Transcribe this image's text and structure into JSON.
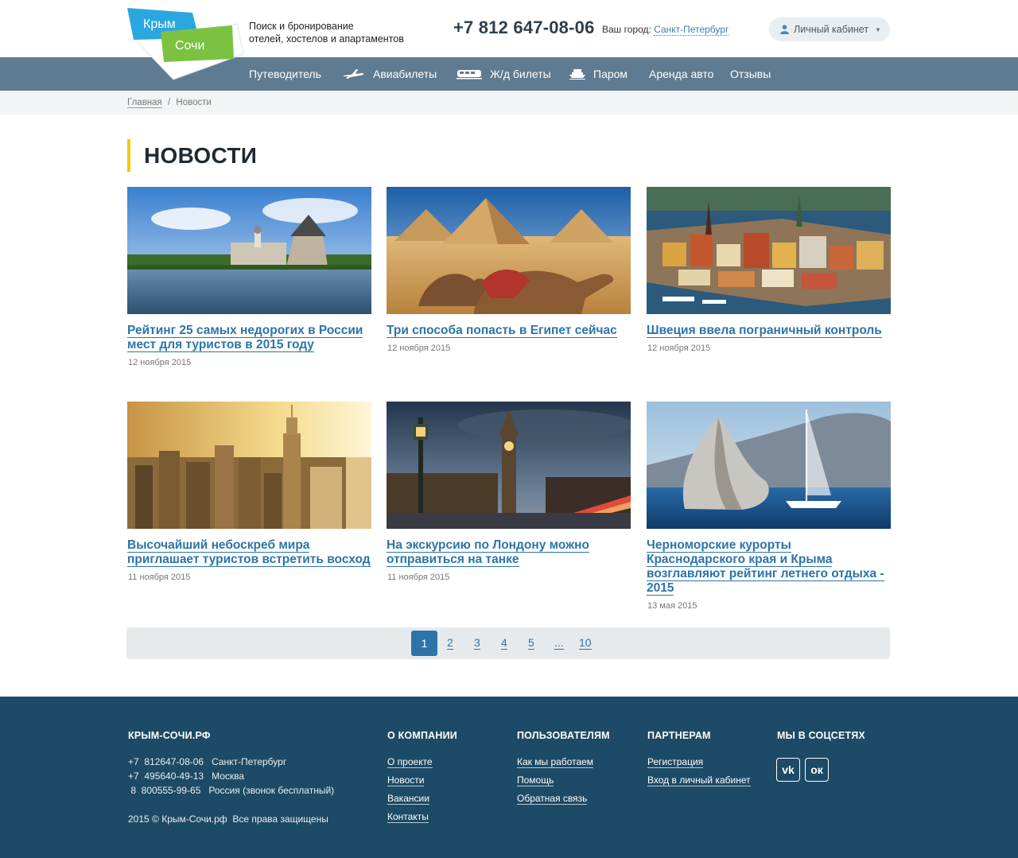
{
  "header": {
    "logo": {
      "line1": "Крым",
      "line2": "Сочи"
    },
    "tagline_1": "Поиск и бронирование",
    "tagline_2": "отелей, хостелов и апартаментов",
    "phone": "+7 812 647-08-06",
    "city_label": "Ваш город:",
    "city_value": "Санкт-Петербург",
    "cabinet_label": "Личный кабинет"
  },
  "nav": {
    "items": [
      {
        "label": "Путеводитель",
        "icon": ""
      },
      {
        "label": "Авиабилеты",
        "icon": "plane-icon"
      },
      {
        "label": "Ж/д билеты",
        "icon": "train-icon"
      },
      {
        "label": "Паром",
        "icon": "ferry-icon"
      },
      {
        "label": "Аренда авто",
        "icon": ""
      },
      {
        "label": "Отзывы",
        "icon": ""
      }
    ]
  },
  "breadcrumb": {
    "home": "Главная",
    "separator": "/",
    "current": "Новости"
  },
  "page": {
    "title": "НОВОСТИ"
  },
  "news": [
    {
      "title": "Рейтинг 25 самых недорогих в России мест для туристов в 2015 году",
      "date": "12 ноября 2015"
    },
    {
      "title": "Три способа попасть в Египет сейчас",
      "date": "12 ноября 2015"
    },
    {
      "title": "Швеция ввела пограничный контроль",
      "date": "12 ноября 2015"
    },
    {
      "title": "Высочайший небоскреб мира приглашает туристов встретить восход",
      "date": "11 ноября 2015"
    },
    {
      "title": "На экскурсию по Лондону можно отправиться на танке",
      "date": "11 ноября 2015"
    },
    {
      "title": "Черноморские курорты Краснодарского края и Крыма возглавляют рейтинг летнего отдыха - 2015",
      "date": "13 мая 2015"
    }
  ],
  "pagination": {
    "pages": [
      "1",
      "2",
      "3",
      "4",
      "5",
      "...",
      "10"
    ],
    "current": "1"
  },
  "footer": {
    "brand": "КРЫМ-СОЧИ.РФ",
    "contacts": [
      "+7  812647-08-06   Санкт-Петербург",
      "+7  495640-49-13   Москва",
      " 8  800555-99-65   Россия (звонок бесплатный)"
    ],
    "copyright": "2015 © Крым-Сочи.рф  Все права защищены",
    "about": {
      "title": "О КОМПАНИИ",
      "links": [
        "О проекте",
        "Новости",
        "Вакансии",
        "Контакты"
      ]
    },
    "users": {
      "title": "ПОЛЬЗОВАТЕЛЯМ",
      "links": [
        "Как мы работаем",
        "Помощь",
        "Обратная связь"
      ]
    },
    "partners": {
      "title": "ПАРТНЕРАМ",
      "links": [
        "Регистрация",
        "Вход в личный кабинет"
      ]
    },
    "social": {
      "title": "МЫ В СОЦСЕТЯХ",
      "items": [
        {
          "icon": "vk-icon",
          "glyph": "vk"
        },
        {
          "icon": "odnoklassniki-icon",
          "glyph": "ок"
        }
      ]
    }
  },
  "colors": {
    "nav_bg": "#5e7b91",
    "link": "#2d74a8",
    "accent": "#f5c514",
    "footer_bg": "#1d4a66"
  }
}
